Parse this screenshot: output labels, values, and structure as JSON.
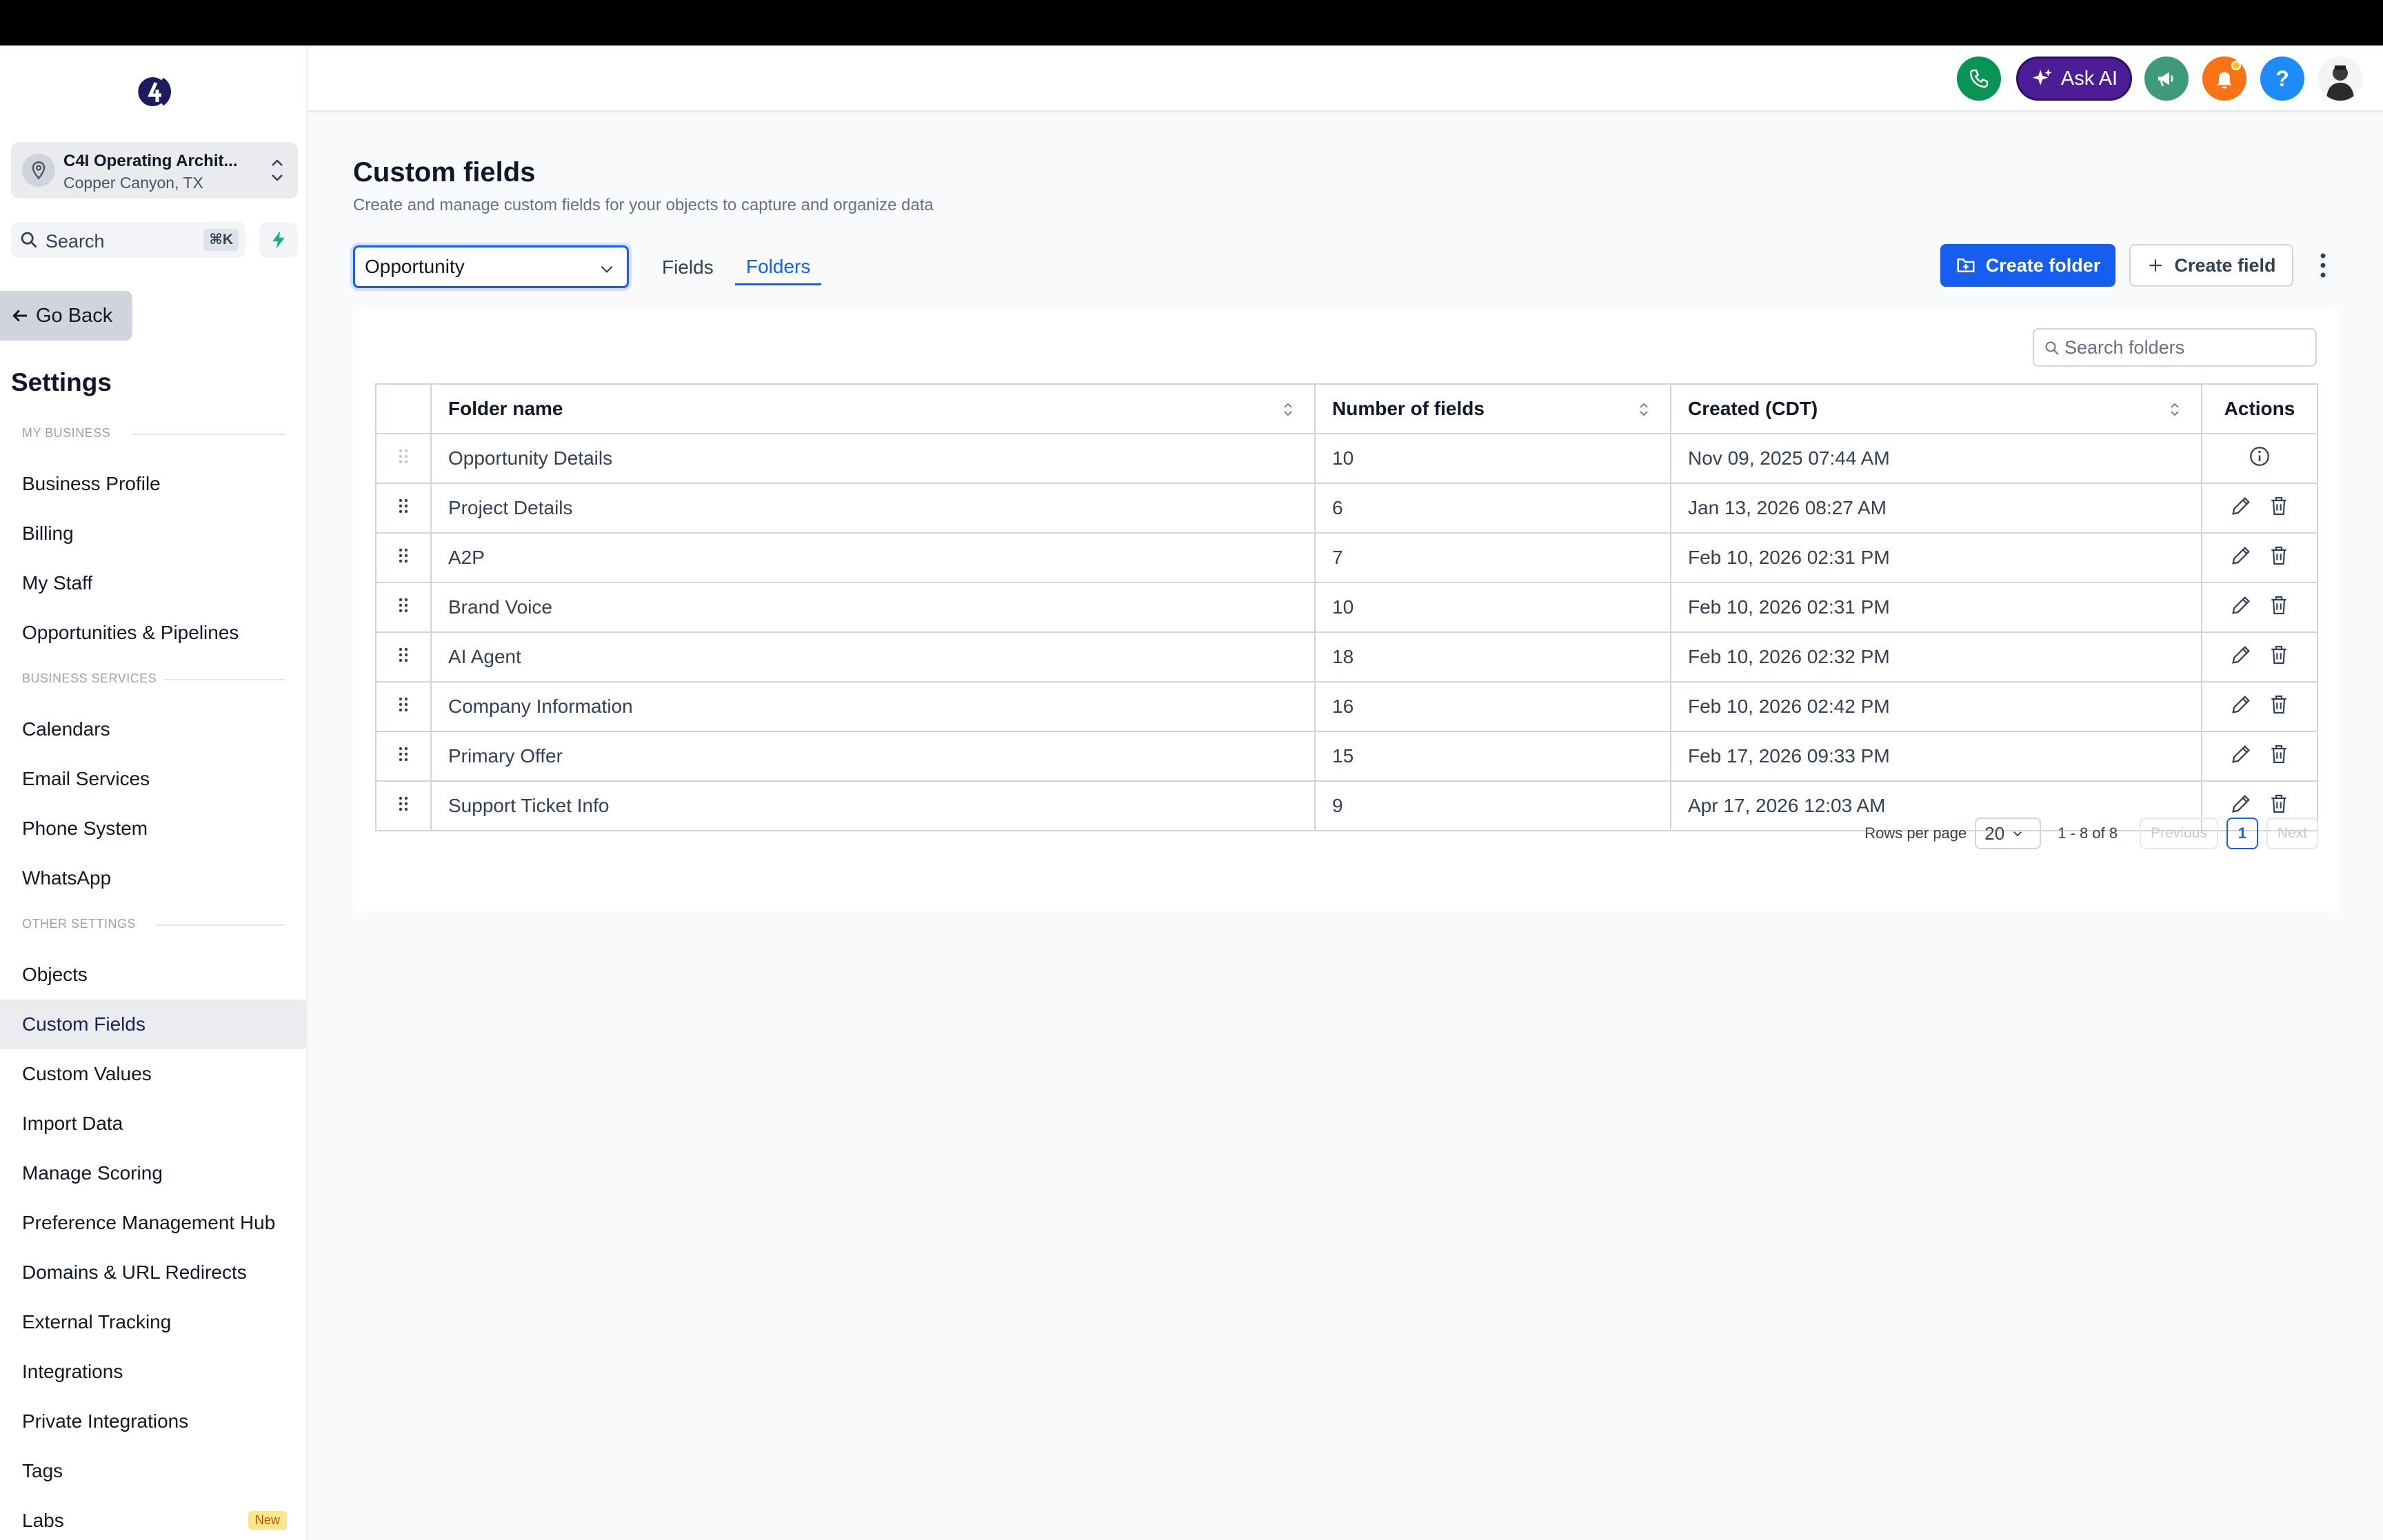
{
  "sidebar": {
    "location": {
      "name": "C4I Operating Archit...",
      "sub": "Copper Canyon, TX"
    },
    "search": {
      "label": "Search",
      "shortcut": "⌘K"
    },
    "go_back": "Go Back",
    "title": "Settings",
    "sections": [
      {
        "header": "MY BUSINESS",
        "items": [
          "Business Profile",
          "Billing",
          "My Staff",
          "Opportunities & Pipelines"
        ]
      },
      {
        "header": "BUSINESS SERVICES",
        "items": [
          "Calendars",
          "Email Services",
          "Phone System",
          "WhatsApp"
        ]
      },
      {
        "header": "OTHER SETTINGS",
        "items": [
          "Objects",
          "Custom Fields",
          "Custom Values",
          "Import Data",
          "Manage Scoring",
          "Preference Management Hub",
          "Domains & URL Redirects",
          "External Tracking",
          "Integrations",
          "Private Integrations",
          "Tags",
          "Labs"
        ]
      }
    ],
    "active_item": "Custom Fields",
    "labs_badge": "New"
  },
  "topbar": {
    "ask_ai": "Ask AI",
    "help": "?",
    "colors": {
      "phone": "#079455",
      "ask_ai": "#4c1d95",
      "megaphone": "#3f9a7b",
      "bell": "#f97316",
      "help": "#1d8cf8"
    }
  },
  "page": {
    "title": "Custom fields",
    "subtitle": "Create and manage custom fields for your objects to capture and organize data",
    "object_select": "Opportunity",
    "tabs": {
      "fields": "Fields",
      "folders": "Folders"
    },
    "create_folder": "Create folder",
    "create_field": "Create field",
    "search_placeholder": "Search folders"
  },
  "table": {
    "headers": {
      "name": "Folder name",
      "count": "Number of fields",
      "created": "Created (CDT)",
      "actions": "Actions"
    },
    "rows": [
      {
        "name": "Opportunity Details",
        "count": "10",
        "created": "Nov 09, 2025 07:44 AM",
        "locked": true
      },
      {
        "name": "Project Details",
        "count": "6",
        "created": "Jan 13, 2026 08:27 AM",
        "locked": false
      },
      {
        "name": "A2P",
        "count": "7",
        "created": "Feb 10, 2026 02:31 PM",
        "locked": false
      },
      {
        "name": "Brand Voice",
        "count": "10",
        "created": "Feb 10, 2026 02:31 PM",
        "locked": false
      },
      {
        "name": "AI Agent",
        "count": "18",
        "created": "Feb 10, 2026 02:32 PM",
        "locked": false
      },
      {
        "name": "Company Information",
        "count": "16",
        "created": "Feb 10, 2026 02:42 PM",
        "locked": false
      },
      {
        "name": "Primary Offer",
        "count": "15",
        "created": "Feb 17, 2026 09:33 PM",
        "locked": false
      },
      {
        "name": "Support Ticket Info",
        "count": "9",
        "created": "Apr 17, 2026 12:03 AM",
        "locked": false
      }
    ]
  },
  "pagination": {
    "rows_per_page_label": "Rows per page",
    "rows_per_page": "20",
    "range": "1 - 8 of 8",
    "previous": "Previous",
    "page": "1",
    "next": "Next"
  }
}
